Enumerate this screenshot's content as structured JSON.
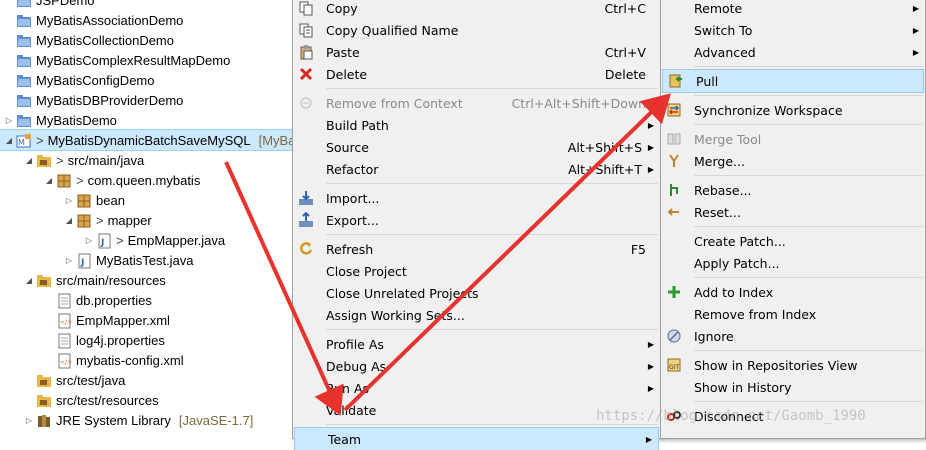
{
  "tree": [
    {
      "label": "JSPDemo",
      "depth": 0,
      "twisty": "",
      "icon": "project-icon"
    },
    {
      "label": "MyBatisAssociationDemo",
      "depth": 0,
      "twisty": "",
      "icon": "project-icon"
    },
    {
      "label": "MyBatisCollectionDemo",
      "depth": 0,
      "twisty": "",
      "icon": "project-icon"
    },
    {
      "label": "MyBatisComplexResultMapDemo",
      "depth": 0,
      "twisty": "",
      "icon": "project-icon"
    },
    {
      "label": "MyBatisConfigDemo",
      "depth": 0,
      "twisty": "",
      "icon": "project-icon"
    },
    {
      "label": "MyBatisDBProviderDemo",
      "depth": 0,
      "twisty": "",
      "icon": "project-icon"
    },
    {
      "label": "MyBatisDemo",
      "depth": 0,
      "twisty": "▷",
      "icon": "project-icon"
    },
    {
      "label": "MyBatisDynamicBatchSaveMySQL",
      "suffix": "[MyBa",
      "decor": ">",
      "depth": 0,
      "twisty": "◢",
      "icon": "maven-project-icon",
      "selected": true
    },
    {
      "label": "src/main/java",
      "decor": ">",
      "depth": 1,
      "twisty": "◢",
      "icon": "source-folder-icon"
    },
    {
      "label": "com.queen.mybatis",
      "decor": ">",
      "depth": 2,
      "twisty": "◢",
      "icon": "package-icon"
    },
    {
      "label": "bean",
      "depth": 3,
      "twisty": "▷",
      "icon": "package-icon"
    },
    {
      "label": "mapper",
      "decor": ">",
      "depth": 3,
      "twisty": "◢",
      "icon": "package-icon"
    },
    {
      "label": "EmpMapper.java",
      "decor": ">",
      "depth": 4,
      "twisty": "▷",
      "icon": "java-file-icon"
    },
    {
      "label": "MyBatisTest.java",
      "depth": 3,
      "twisty": "▷",
      "icon": "java-file-icon"
    },
    {
      "label": "src/main/resources",
      "depth": 1,
      "twisty": "◢",
      "icon": "source-folder-icon"
    },
    {
      "label": "db.properties",
      "depth": 2,
      "twisty": "",
      "icon": "file-icon"
    },
    {
      "label": "EmpMapper.xml",
      "depth": 2,
      "twisty": "",
      "icon": "xml-file-icon"
    },
    {
      "label": "log4j.properties",
      "depth": 2,
      "twisty": "",
      "icon": "file-icon"
    },
    {
      "label": "mybatis-config.xml",
      "depth": 2,
      "twisty": "",
      "icon": "xml-file-icon"
    },
    {
      "label": "src/test/java",
      "depth": 1,
      "twisty": "",
      "icon": "source-folder-icon"
    },
    {
      "label": "src/test/resources",
      "depth": 1,
      "twisty": "",
      "icon": "source-folder-icon"
    },
    {
      "label": "JRE System Library",
      "suffix": "[JavaSE-1.7]",
      "depth": 1,
      "twisty": "▷",
      "icon": "library-icon"
    }
  ],
  "context_menu": [
    {
      "label": "Copy",
      "accel": "Ctrl+C",
      "icon": "copy-icon"
    },
    {
      "label": "Copy Qualified Name",
      "icon": "copy-qualified-icon"
    },
    {
      "label": "Paste",
      "accel": "Ctrl+V",
      "icon": "paste-icon"
    },
    {
      "label": "Delete",
      "accel": "Delete",
      "icon": "delete-icon"
    },
    {
      "sep": true
    },
    {
      "label": "Remove from Context",
      "accel": "Ctrl+Alt+Shift+Down",
      "icon": "remove-context-icon",
      "disabled": true
    },
    {
      "label": "Build Path",
      "submenu": true
    },
    {
      "label": "Source",
      "accel": "Alt+Shift+S",
      "submenu": true
    },
    {
      "label": "Refactor",
      "accel": "Alt+Shift+T",
      "submenu": true
    },
    {
      "sep": true
    },
    {
      "label": "Import...",
      "icon": "import-icon"
    },
    {
      "label": "Export...",
      "icon": "export-icon"
    },
    {
      "sep": true
    },
    {
      "label": "Refresh",
      "accel": "F5",
      "icon": "refresh-icon"
    },
    {
      "label": "Close Project"
    },
    {
      "label": "Close Unrelated Projects"
    },
    {
      "label": "Assign Working Sets..."
    },
    {
      "sep": true
    },
    {
      "label": "Profile As",
      "submenu": true
    },
    {
      "label": "Debug As",
      "submenu": true
    },
    {
      "label": "Run As",
      "submenu": true
    },
    {
      "label": "Validate"
    },
    {
      "sep": true
    },
    {
      "label": "Team",
      "submenu": true,
      "highlight": true
    }
  ],
  "team_menu": [
    {
      "label": "Remote",
      "submenu": true
    },
    {
      "label": "Switch To",
      "submenu": true
    },
    {
      "label": "Advanced",
      "submenu": true
    },
    {
      "sep": true
    },
    {
      "label": "Pull",
      "icon": "pull-icon",
      "highlight": true
    },
    {
      "sep": true
    },
    {
      "label": "Synchronize Workspace",
      "icon": "synchronize-icon"
    },
    {
      "sep": true
    },
    {
      "label": "Merge Tool",
      "icon": "merge-tool-icon",
      "disabled": true
    },
    {
      "label": "Merge...",
      "icon": "merge-icon"
    },
    {
      "sep": true
    },
    {
      "label": "Rebase...",
      "icon": "rebase-icon"
    },
    {
      "label": "Reset...",
      "icon": "reset-icon"
    },
    {
      "sep": true
    },
    {
      "label": "Create Patch..."
    },
    {
      "label": "Apply Patch..."
    },
    {
      "sep": true
    },
    {
      "label": "Add to Index",
      "icon": "add-index-icon"
    },
    {
      "label": "Remove from Index"
    },
    {
      "label": "Ignore",
      "icon": "ignore-icon"
    },
    {
      "sep": true
    },
    {
      "label": "Show in Repositories View",
      "icon": "repositories-view-icon"
    },
    {
      "label": "Show in History"
    },
    {
      "sep": true
    },
    {
      "label": "Disconnect",
      "icon": "disconnect-icon"
    }
  ],
  "watermark": "https://blog.csdn.net/Gaomb_1990",
  "colors": {
    "selection": "#cce8ff",
    "menu_bg": "#f0f0f0",
    "arrow": "#e8322d"
  }
}
